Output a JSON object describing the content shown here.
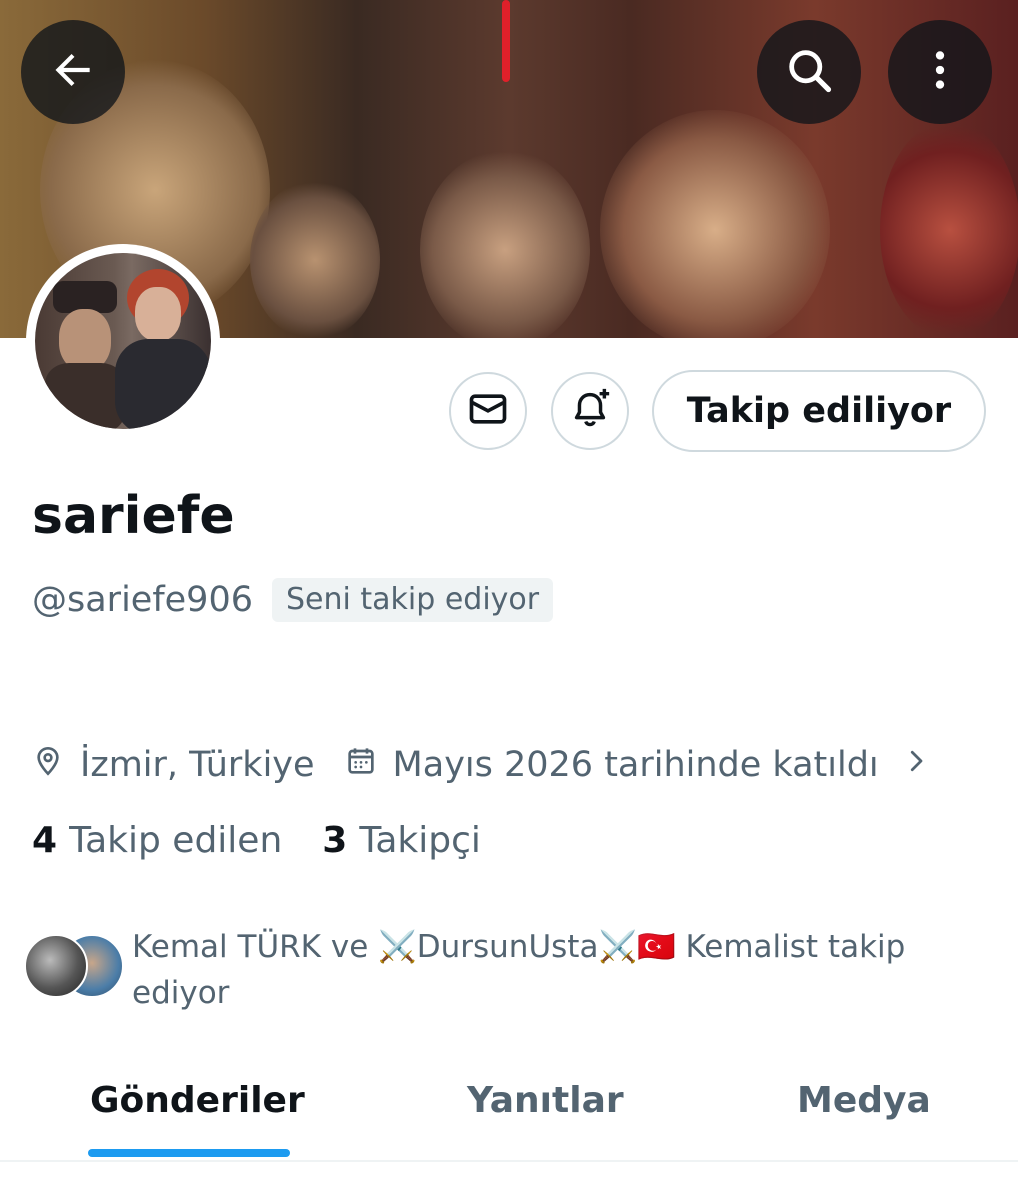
{
  "profile": {
    "display_name": "sariefe",
    "handle": "@sariefe906",
    "follows_you": "Seni takip ediyor",
    "location": "İzmir, Türkiye",
    "joined": "Mayıs 2026 tarihinde katıldı",
    "follow_button": "Takip ediliyor"
  },
  "stats": {
    "following_count": "4",
    "following_label": "Takip edilen",
    "followers_count": "3",
    "followers_label": "Takipçi"
  },
  "followed_by": {
    "text": "Kemal TÜRK ve ⚔️DursunUsta⚔️🇹🇷 Kemalist takip ediyor"
  },
  "tabs": [
    {
      "label": "Gönderiler",
      "active": true
    },
    {
      "label": "Yanıtlar",
      "active": false
    },
    {
      "label": "Medya",
      "active": false
    }
  ],
  "icons": {
    "back": "arrow-left-icon",
    "search": "search-icon",
    "more": "more-vertical-icon",
    "message": "envelope-icon",
    "notify": "bell-plus-icon",
    "location": "location-pin-icon",
    "calendar": "calendar-icon",
    "chevron": "chevron-right-icon"
  },
  "colors": {
    "accent": "#1d9bf0",
    "secondary_text": "#536471",
    "primary_text": "#0f1419"
  }
}
